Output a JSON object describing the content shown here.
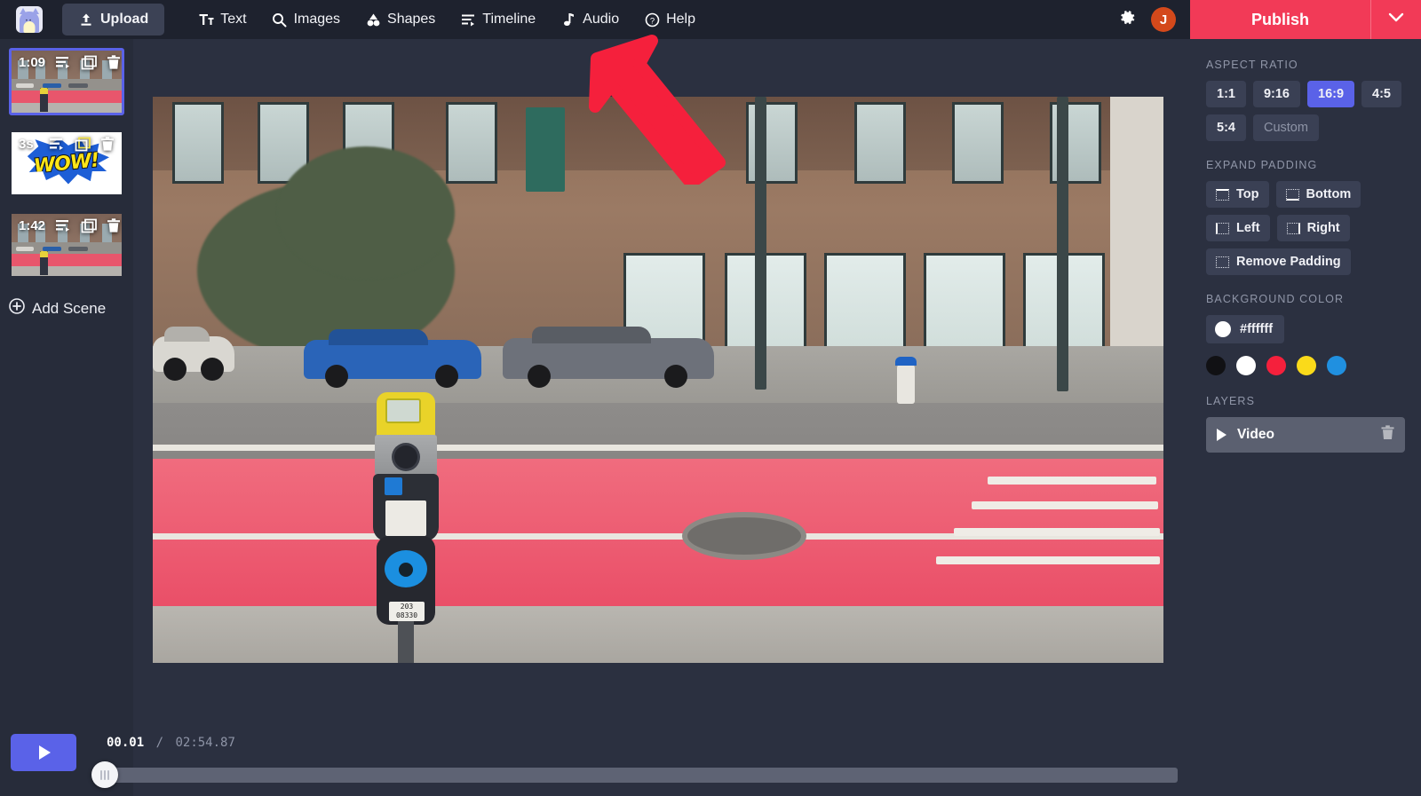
{
  "app": {
    "logo_icon": "cat-logo-icon"
  },
  "toolbar": {
    "upload_label": "Upload",
    "items": [
      {
        "label": "Text",
        "icon": "text-icon"
      },
      {
        "label": "Images",
        "icon": "search-icon"
      },
      {
        "label": "Shapes",
        "icon": "shapes-icon"
      },
      {
        "label": "Timeline",
        "icon": "timeline-icon"
      },
      {
        "label": "Audio",
        "icon": "music-note-icon"
      },
      {
        "label": "Help",
        "icon": "question-circle-icon"
      }
    ],
    "settings_icon": "gear-icon",
    "avatar_initial": "J",
    "publish_label": "Publish",
    "publish_caret_icon": "chevron-down-icon"
  },
  "scenes": {
    "items": [
      {
        "duration": "1:09",
        "type": "street",
        "selected": true
      },
      {
        "duration": "3s",
        "type": "wow",
        "selected": false,
        "overlay_text": "WOW!"
      },
      {
        "duration": "1:42",
        "type": "street",
        "selected": false
      }
    ],
    "action_icons": [
      "scene-settings-icon",
      "duplicate-icon",
      "delete-icon"
    ],
    "add_scene_label": "Add Scene",
    "add_scene_icon": "plus-circle-icon"
  },
  "canvas": {
    "meter_plate_line1": "203",
    "meter_plate_line2": "08330"
  },
  "annotation": {
    "arrow_icon": "red-arrow-up-left",
    "arrow_color": "#f5203c",
    "points_at": "Audio"
  },
  "right_panel": {
    "aspect_ratio": {
      "title": "Aspect Ratio",
      "options": [
        "1:1",
        "9:16",
        "16:9",
        "4:5",
        "5:4",
        "Custom"
      ],
      "selected": "16:9",
      "muted": "Custom"
    },
    "expand_padding": {
      "title": "Expand Padding",
      "options": [
        "Top",
        "Bottom",
        "Left",
        "Right",
        "Remove Padding"
      ]
    },
    "background_color": {
      "title": "Background Color",
      "current": "#ffffff",
      "swatches": [
        "#111114",
        "#ffffff",
        "#f5203c",
        "#fada1a",
        "#2090e0"
      ]
    },
    "layers": {
      "title": "Layers",
      "items": [
        {
          "name": "Video",
          "expand_icon": "play-triangle-icon",
          "delete_icon": "trash-icon"
        }
      ]
    }
  },
  "player": {
    "play_icon": "play-icon",
    "current_time": "00.01",
    "separator": "/",
    "total_time": "02:54.87",
    "progress_percent": 0
  }
}
